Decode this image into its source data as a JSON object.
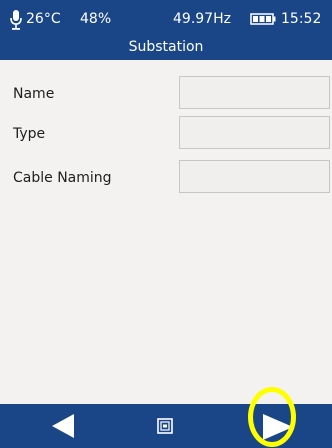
{
  "status_bar": {
    "temperature": "26°C",
    "humidity": "48%",
    "frequency": "49.97Hz",
    "time": "15:52"
  },
  "header": {
    "title": "Substation"
  },
  "form": {
    "fields": [
      {
        "label": "Name",
        "value": ""
      },
      {
        "label": "Type",
        "value": ""
      },
      {
        "label": "Cable Naming",
        "value": ""
      }
    ]
  },
  "icons": {
    "status": [
      "microphone-icon",
      "battery-icon"
    ],
    "navigation": [
      "back-arrow-icon",
      "menu-icon",
      "next-arrow-icon"
    ]
  },
  "colors": {
    "bar": "#1a4687",
    "content_background": "#f3f2f1",
    "highlight": "#ffff00"
  }
}
